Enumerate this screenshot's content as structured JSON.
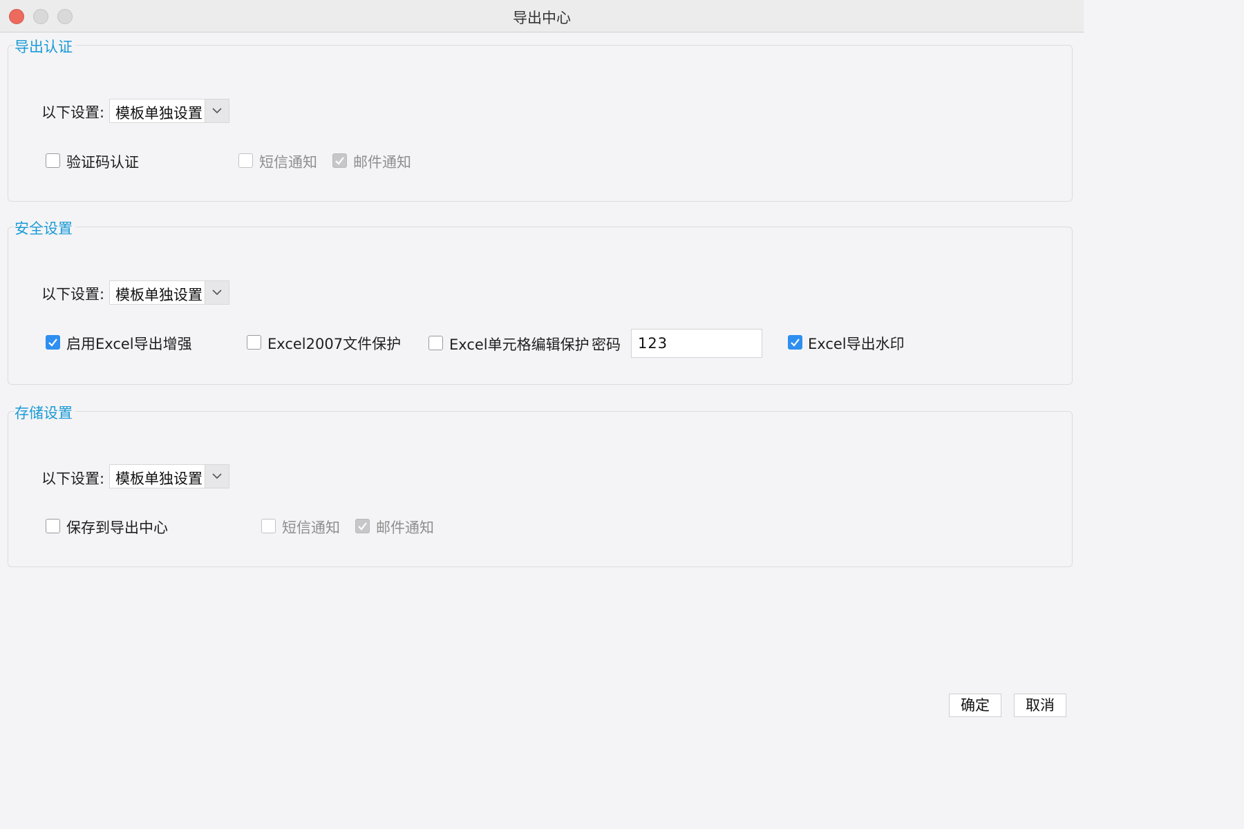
{
  "window": {
    "title": "导出中心"
  },
  "export_auth": {
    "legend": "导出认证",
    "setting_label": "以下设置:",
    "setting_value": "模板单独设置",
    "captcha": {
      "label": "验证码认证",
      "checked": false
    },
    "sms": {
      "label": "短信通知",
      "checked": false,
      "enabled": false
    },
    "email": {
      "label": "邮件通知",
      "checked": true,
      "enabled": false
    }
  },
  "security": {
    "legend": "安全设置",
    "setting_label": "以下设置:",
    "setting_value": "模板单独设置",
    "enhance": {
      "label": "启用Excel导出增强",
      "checked": true
    },
    "excel2007": {
      "label": "Excel2007文件保护",
      "checked": false
    },
    "cell_protect": {
      "label": "Excel单元格编辑保护",
      "checked": false
    },
    "password_label": "密码",
    "password_value": "123",
    "watermark": {
      "label": "Excel导出水印",
      "checked": true
    }
  },
  "storage": {
    "legend": "存储设置",
    "setting_label": "以下设置:",
    "setting_value": "模板单独设置",
    "save_center": {
      "label": "保存到导出中心",
      "checked": false
    },
    "sms": {
      "label": "短信通知",
      "checked": false,
      "enabled": false
    },
    "email": {
      "label": "邮件通知",
      "checked": true,
      "enabled": false
    }
  },
  "footer": {
    "ok_label": "确定",
    "cancel_label": "取消"
  },
  "colors": {
    "accent": "#1a9ad6",
    "checkbox_checked": "#2e8ff0",
    "close_button": "#ed6a5e"
  }
}
